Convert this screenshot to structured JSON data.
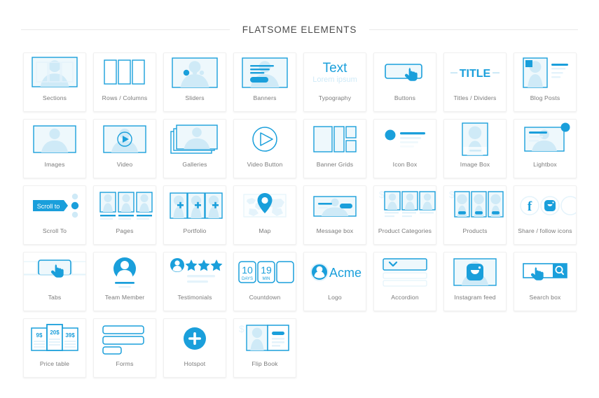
{
  "header": {
    "title": "FLATSOME ELEMENTS"
  },
  "colors": {
    "accent": "#1a9fdb",
    "accent_dark": "#1390cf",
    "pale": "#cfeaf7",
    "pale_light": "#e4f3fb",
    "pale_faint": "#eef8fc",
    "label_text": "#7a7a7a",
    "title_text": "#4a4a4a",
    "card_bg": "#ffffff",
    "card_border": "#f0f0f0",
    "page_bg": "#ffffff",
    "rule": "#e8e8e8"
  },
  "grid": {
    "columns": 8,
    "rows": 5,
    "items": [
      {
        "id": "sections",
        "label": "Sections",
        "icon": "sections-icon"
      },
      {
        "id": "rows-columns",
        "label": "Rows / Columns",
        "icon": "rows-columns-icon"
      },
      {
        "id": "sliders",
        "label": "Sliders",
        "icon": "sliders-icon"
      },
      {
        "id": "banners",
        "label": "Banners",
        "icon": "banners-icon"
      },
      {
        "id": "typography",
        "label": "Typography",
        "icon": "typography-icon",
        "text_main": "Text",
        "text_sub": "Lorem ipsum"
      },
      {
        "id": "buttons",
        "label": "Buttons",
        "icon": "buttons-icon"
      },
      {
        "id": "titles-dividers",
        "label": "Titles / Dividers",
        "icon": "titles-dividers-icon",
        "text_main": "TITLE"
      },
      {
        "id": "blog-posts",
        "label": "Blog Posts",
        "icon": "blog-posts-icon"
      },
      {
        "id": "images",
        "label": "Images",
        "icon": "images-icon"
      },
      {
        "id": "video",
        "label": "Video",
        "icon": "video-icon"
      },
      {
        "id": "galleries",
        "label": "Galleries",
        "icon": "galleries-icon"
      },
      {
        "id": "video-button",
        "label": "Video Button",
        "icon": "video-button-icon"
      },
      {
        "id": "banner-grids",
        "label": "Banner Grids",
        "icon": "banner-grids-icon"
      },
      {
        "id": "icon-box",
        "label": "Icon Box",
        "icon": "icon-box-icon"
      },
      {
        "id": "image-box",
        "label": "Image Box",
        "icon": "image-box-icon"
      },
      {
        "id": "lightbox",
        "label": "Lightbox",
        "icon": "lightbox-icon"
      },
      {
        "id": "scroll-to",
        "label": "Scroll To",
        "icon": "scroll-to-icon",
        "text_main": "Scroll to"
      },
      {
        "id": "pages",
        "label": "Pages",
        "icon": "pages-icon"
      },
      {
        "id": "portfolio",
        "label": "Portfolio",
        "icon": "portfolio-icon"
      },
      {
        "id": "map",
        "label": "Map",
        "icon": "map-icon"
      },
      {
        "id": "message-box",
        "label": "Message box",
        "icon": "message-box-icon"
      },
      {
        "id": "product-categories",
        "label": "Product Categories",
        "icon": "product-categories-icon"
      },
      {
        "id": "products",
        "label": "Products",
        "icon": "products-icon"
      },
      {
        "id": "share-follow-icons",
        "label": "Share / follow icons",
        "icon": "share-follow-icons-icon"
      },
      {
        "id": "tabs",
        "label": "Tabs",
        "icon": "tabs-icon"
      },
      {
        "id": "team-member",
        "label": "Team Member",
        "icon": "team-member-icon"
      },
      {
        "id": "testimonials",
        "label": "Testimonials",
        "icon": "testimonials-icon"
      },
      {
        "id": "countdown",
        "label": "Countdown",
        "icon": "countdown-icon",
        "days_value": "10",
        "days_unit": "DAYS",
        "min_value": "19",
        "min_unit": "MIN"
      },
      {
        "id": "logo",
        "label": "Logo",
        "icon": "logo-icon",
        "text_main": "Acme"
      },
      {
        "id": "accordion",
        "label": "Accordion",
        "icon": "accordion-icon"
      },
      {
        "id": "instagram-feed",
        "label": "Instagram feed",
        "icon": "instagram-feed-icon"
      },
      {
        "id": "search-box",
        "label": "Search box",
        "icon": "search-box-icon"
      },
      {
        "id": "price-table",
        "label": "Price table",
        "icon": "price-table-icon",
        "price_1": "9$",
        "price_2": "20$",
        "price_3": "39$"
      },
      {
        "id": "forms",
        "label": "Forms",
        "icon": "forms-icon"
      },
      {
        "id": "hotspot",
        "label": "Hotspot",
        "icon": "hotspot-icon"
      },
      {
        "id": "flip-book",
        "label": "Flip Book",
        "icon": "flip-book-icon"
      }
    ]
  }
}
